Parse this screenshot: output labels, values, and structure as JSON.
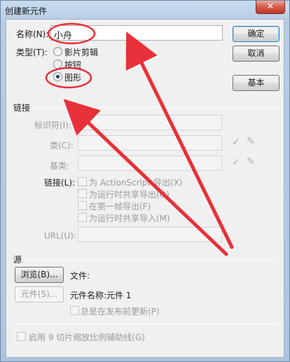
{
  "window": {
    "title": "创建新元件",
    "close_glyph": "✕"
  },
  "form": {
    "name_label": "名称(N):",
    "name_value": "小舟",
    "type_label": "类型(T):",
    "type_options": [
      "影片剪辑",
      "按钮",
      "图形"
    ],
    "type_selected": "图形"
  },
  "buttons": {
    "ok": "确定",
    "cancel": "取消",
    "basic": "基本"
  },
  "linkage": {
    "section_title": "链接",
    "identifier_label": "标识符(I):",
    "class_label": "类(C):",
    "base_class_label": "基类:",
    "linkage_label": "链接(L):",
    "options": [
      "为 ActionScript 导出(X)",
      "为运行时共享导出(O)",
      "在第一帧导出(F)",
      "为运行时共享导入(M)"
    ],
    "url_label": "URL(U):"
  },
  "source": {
    "section_title": "源",
    "browse_button": "浏览(B)...",
    "file_label": "文件:",
    "symbol_button": "元件(S)...",
    "symbol_name": "元件名称:元件 1",
    "always_update": "总是在发布前更新(P)"
  },
  "footer": {
    "nine_slice": "启用 9 切片缩放比例辅助线(G)"
  },
  "icons": {
    "check": "check-icon",
    "pencil": "pencil-icon"
  },
  "annotation_color": "#e8303a"
}
